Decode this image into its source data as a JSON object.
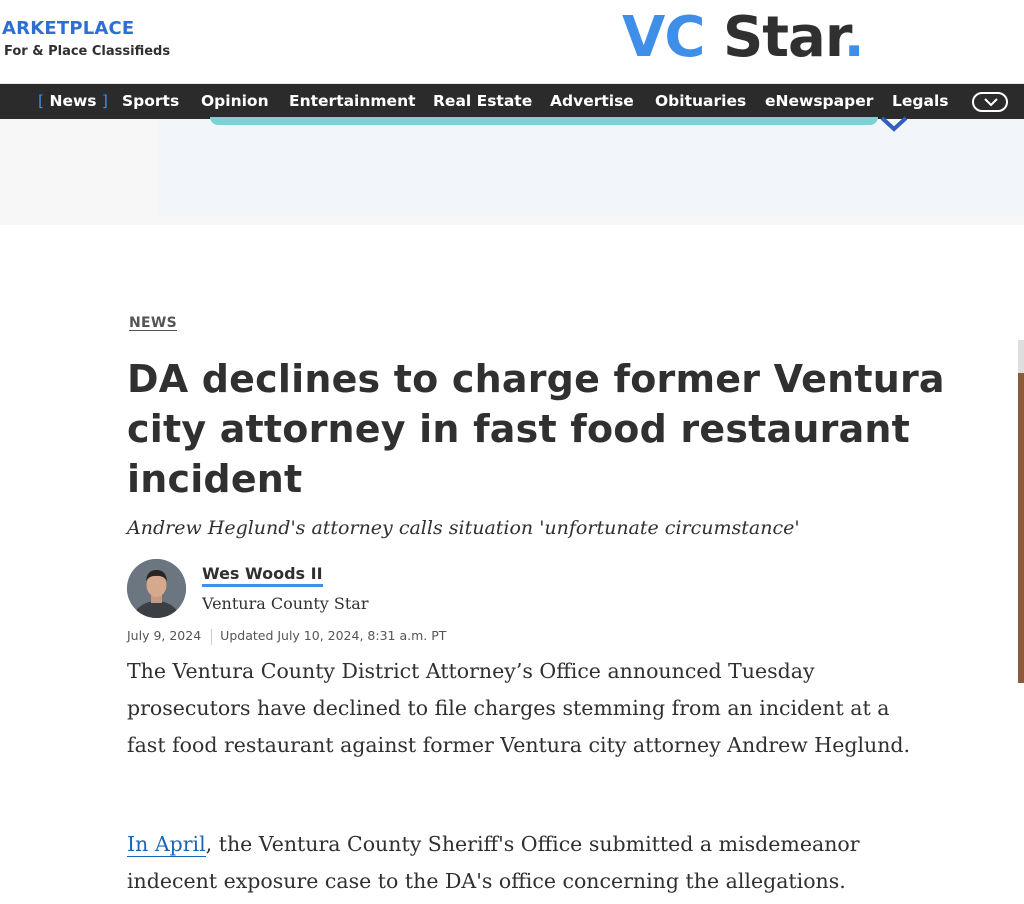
{
  "masthead": {
    "marketplace_title": "ARKETPLACE",
    "marketplace_subtitle": "For & Place Classifieds",
    "logo_vc": "VC",
    "logo_star": "Star",
    "logo_dot": "."
  },
  "nav": {
    "items": [
      "News",
      "Sports",
      "Opinion",
      "Entertainment",
      "Real Estate",
      "Advertise",
      "Obituaries",
      "eNewspaper",
      "Legals"
    ],
    "bracket_open": "[",
    "bracket_close": "]",
    "active": "News",
    "more_icon": "chevron-down-icon"
  },
  "article": {
    "category": "NEWS",
    "headline": "DA declines to charge former Ventura city attorney in fast food restaurant incident",
    "dek": "Andrew Heglund's attorney calls situation 'unfortunate circumstance'",
    "author": {
      "name": "Wes Woods II",
      "org": "Ventura County Star"
    },
    "published": "July 9, 2024",
    "updated": "Updated July 10, 2024, 8:31 a.m. PT",
    "paragraph1": "The Ventura County District Attorney’s Office announced Tuesday prosecutors have declined to file charges stemming from an incident at a fast food restaurant against former Ventura city attorney Andrew Heglund.",
    "paragraph2_link": "In April",
    "paragraph2_rest": ", the Ventura County Sheriff's Office submitted a misdemeanor indecent exposure case to the DA's office concerning the allegations."
  },
  "colors": {
    "accent": "#3f8ee8",
    "navbar": "#2b2b2b",
    "text": "#303030",
    "link": "#1a66b8"
  }
}
